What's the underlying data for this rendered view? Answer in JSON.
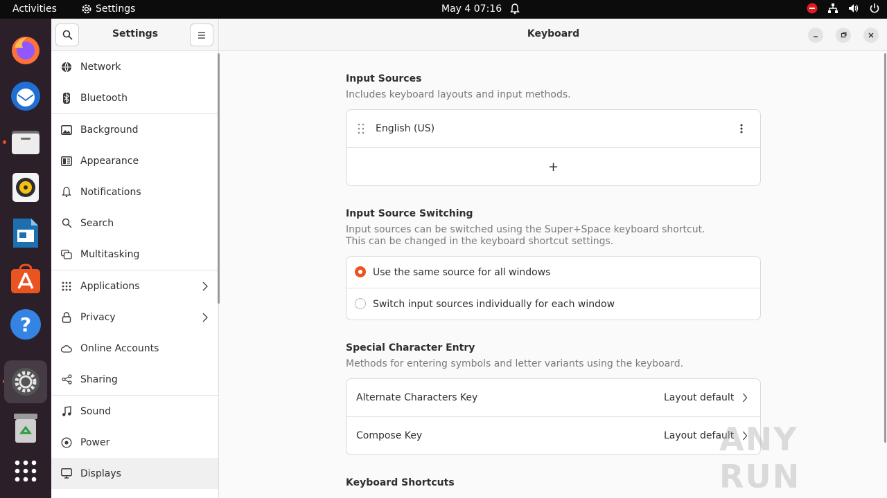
{
  "topbar": {
    "activities": "Activities",
    "app_name": "Settings",
    "clock": "May 4  07:16"
  },
  "dock": {
    "items": [
      "firefox-icon",
      "thunderbird-icon",
      "files-icon",
      "rhythmbox-icon",
      "writer-icon",
      "app-center-icon",
      "help-icon",
      "settings-icon",
      "trash-icon",
      "show-apps-icon"
    ]
  },
  "sidebar": {
    "title": "Settings",
    "items": [
      {
        "label": "Network",
        "icon": "network-icon"
      },
      {
        "label": "Bluetooth",
        "icon": "bluetooth-icon"
      },
      {
        "label": "Background",
        "icon": "background-icon"
      },
      {
        "label": "Appearance",
        "icon": "appearance-icon"
      },
      {
        "label": "Notifications",
        "icon": "bell-icon"
      },
      {
        "label": "Search",
        "icon": "search-icon"
      },
      {
        "label": "Multitasking",
        "icon": "multitasking-icon"
      },
      {
        "label": "Applications",
        "icon": "applications-icon"
      },
      {
        "label": "Privacy",
        "icon": "lock-icon"
      },
      {
        "label": "Online Accounts",
        "icon": "cloud-icon"
      },
      {
        "label": "Sharing",
        "icon": "share-icon"
      },
      {
        "label": "Sound",
        "icon": "music-note-icon"
      },
      {
        "label": "Power",
        "icon": "power-icon"
      },
      {
        "label": "Displays",
        "icon": "display-icon"
      }
    ]
  },
  "main": {
    "title": "Keyboard",
    "input_sources": {
      "title": "Input Sources",
      "desc": "Includes keyboard layouts and input methods.",
      "source": "English (US)",
      "add": "+"
    },
    "switching": {
      "title": "Input Source Switching",
      "desc_line1": "Input sources can be switched using the Super+Space keyboard shortcut.",
      "desc_line2": "This can be changed in the keyboard shortcut settings.",
      "option1": "Use the same source for all windows",
      "option2": "Switch input sources individually for each window"
    },
    "special": {
      "title": "Special Character Entry",
      "desc": "Methods for entering symbols and letter variants using the keyboard.",
      "alt_label": "Alternate Characters Key",
      "alt_value": "Layout default",
      "compose_label": "Compose Key",
      "compose_value": "Layout default"
    },
    "shortcuts_title": "Keyboard Shortcuts"
  },
  "watermark": "ANY RUN",
  "colors": {
    "accent": "#e95420",
    "topbar": "#0c0c0c",
    "dock": "#2b2029"
  }
}
